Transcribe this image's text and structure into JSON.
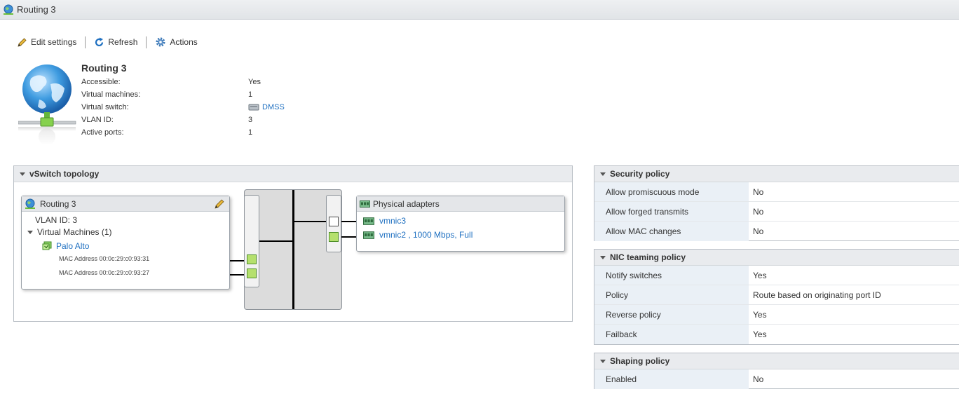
{
  "window": {
    "title": "Routing 3"
  },
  "toolbar": {
    "edit_label": "Edit settings",
    "refresh_label": "Refresh",
    "actions_label": "Actions"
  },
  "summary": {
    "title": "Routing 3",
    "rows": [
      {
        "key": "Accessible:",
        "value": "Yes"
      },
      {
        "key": "Virtual machines:",
        "value": "1"
      },
      {
        "key": "Virtual switch:",
        "value": "DMSS"
      },
      {
        "key": "VLAN ID:",
        "value": "3"
      },
      {
        "key": "Active ports:",
        "value": "1"
      }
    ]
  },
  "topology": {
    "title": "vSwitch topology",
    "portgroup": {
      "name": "Routing 3",
      "vlan": "VLAN ID: 3",
      "vms_label": "Virtual Machines (1)",
      "vm_name": "Palo Alto",
      "macs": [
        "MAC Address 00:0c:29:c0:93:31",
        "MAC Address 00:0c:29:c0:93:27"
      ]
    },
    "adapters": {
      "title": "Physical adapters",
      "items": [
        "vmnic3",
        "vmnic2 , 1000 Mbps, Full"
      ]
    }
  },
  "security": {
    "title": "Security policy",
    "rows": [
      {
        "key": "Allow promiscuous mode",
        "value": "No"
      },
      {
        "key": "Allow forged transmits",
        "value": "No"
      },
      {
        "key": "Allow MAC changes",
        "value": "No"
      }
    ]
  },
  "nic": {
    "title": "NIC teaming policy",
    "rows": [
      {
        "key": "Notify switches",
        "value": "Yes"
      },
      {
        "key": "Policy",
        "value": "Route based on originating port ID"
      },
      {
        "key": "Reverse policy",
        "value": "Yes"
      },
      {
        "key": "Failback",
        "value": "Yes"
      }
    ]
  },
  "shaping": {
    "title": "Shaping policy",
    "rows": [
      {
        "key": "Enabled",
        "value": "No"
      }
    ]
  },
  "colors": {
    "link": "#1f70c1",
    "port_green": "#b5e06e",
    "panel_header": "#e9ebee",
    "policy_key_bg": "#eaf0f6"
  }
}
